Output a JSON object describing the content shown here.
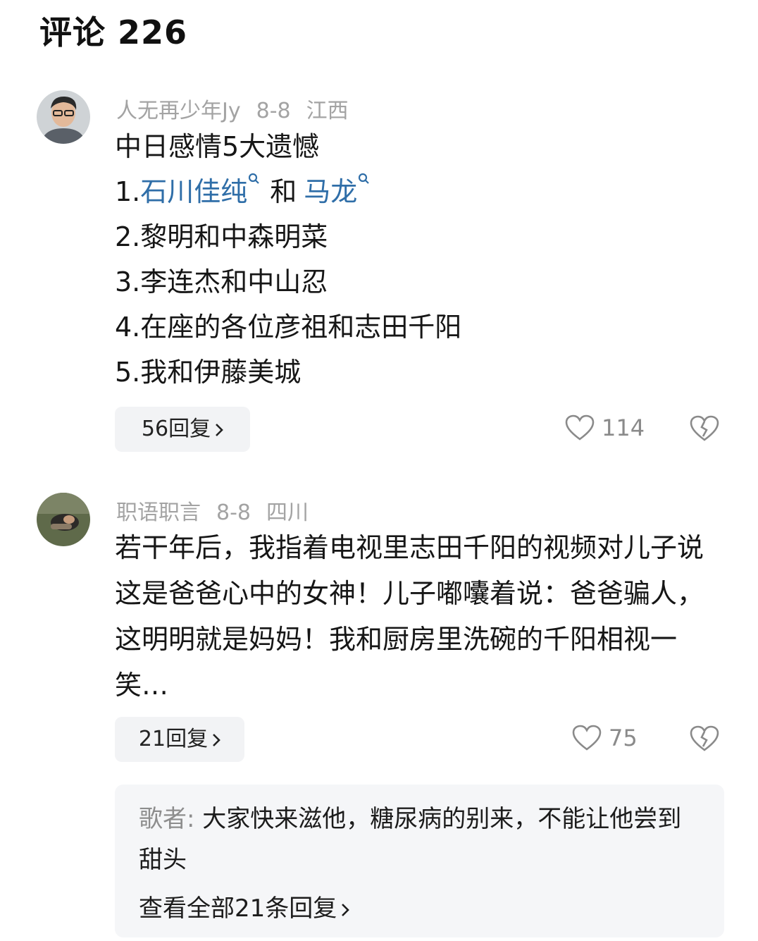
{
  "header": {
    "title": "评论 226"
  },
  "comments": [
    {
      "username": "人无再少年Jy",
      "date": "8-8",
      "location": "江西",
      "lines": {
        "heading": "中日感情5大遗憾",
        "l1_prefix": "1.",
        "l1_link1": "石川佳纯",
        "l1_mid": "和",
        "l1_link2": "马龙",
        "l2": "2.黎明和中森明菜",
        "l3": "3.李连杰和中山忍",
        "l4": "4.在座的各位彦祖和志田千阳",
        "l5": "5.我和伊藤美城"
      },
      "reply_label": "56回复",
      "likes": "114",
      "avatar_icon": "user-photo-icon",
      "link_color": "#2f6ea8"
    },
    {
      "username": "职语职言",
      "date": "8-8",
      "location": "四川",
      "text": "若干年后，我指着电视里志田千阳的视频对儿子说这是爸爸心中的女神！儿子嘟囔着说：爸爸骗人，这明明就是妈妈！我和厨房里洗碗的千阳相视一笑…",
      "reply_label": "21回复",
      "likes": "75",
      "avatar_icon": "user-photo-icon",
      "sub_reply": {
        "author": "歌者:",
        "text": "大家快来滋他，糖尿病的别来，不能让他尝到甜头",
        "view_all": "查看全部21条回复"
      }
    }
  ],
  "colors": {
    "meta": "#a3a3a3",
    "link": "#2f6ea8",
    "button_bg": "#f2f3f5"
  }
}
